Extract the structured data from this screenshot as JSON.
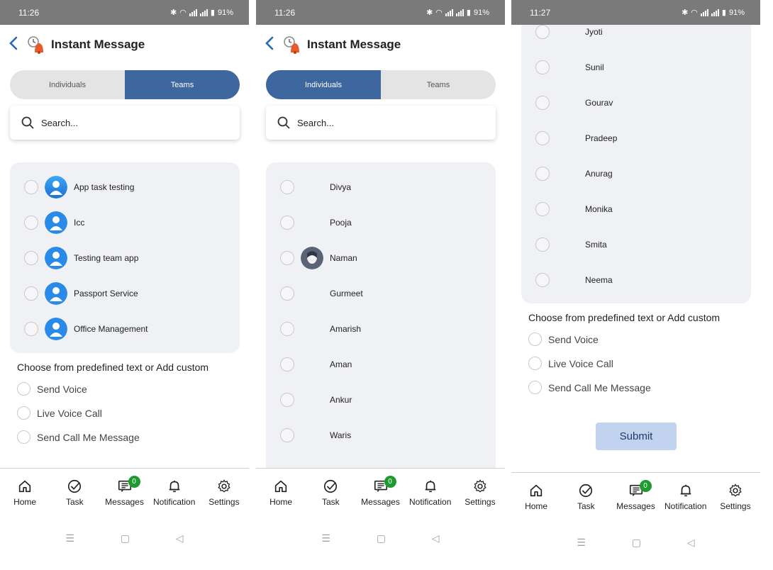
{
  "screens": [
    {
      "status": {
        "time": "11:26",
        "battery": "91%"
      },
      "header": {
        "title": "Instant Message"
      },
      "tabs": [
        {
          "label": "Individuals",
          "active": false
        },
        {
          "label": "Teams",
          "active": true
        }
      ],
      "search": {
        "placeholder": "Search..."
      },
      "list": [
        "App task testing",
        "Icc",
        "Testing team app",
        "Passport Service",
        "Office Management"
      ],
      "choose_text": "Choose from predefined text or Add custom",
      "options": [
        "Send Voice",
        "Live Voice Call",
        "Send Call Me Message"
      ]
    },
    {
      "status": {
        "time": "11:26",
        "battery": "91%"
      },
      "header": {
        "title": "Instant Message"
      },
      "tabs": [
        {
          "label": "Individuals",
          "active": true
        },
        {
          "label": "Teams",
          "active": false
        }
      ],
      "search": {
        "placeholder": "Search..."
      },
      "list": [
        "Divya",
        "Pooja",
        "Naman",
        "Gurmeet",
        "Amarish",
        "Aman",
        "Ankur",
        "Waris"
      ]
    },
    {
      "status": {
        "time": "11:27",
        "battery": "91%"
      },
      "list": [
        "Jyoti",
        "Sunil",
        "Gourav",
        "Pradeep",
        "Anurag",
        "Monika",
        "Smita",
        "Neema"
      ],
      "choose_text": "Choose from predefined text or Add custom",
      "options": [
        "Send Voice",
        "Live Voice Call",
        "Send Call Me Message"
      ],
      "submit_label": "Submit"
    }
  ],
  "nav": {
    "home": "Home",
    "task": "Task",
    "messages": "Messages",
    "messages_badge": "0",
    "notification": "Notification",
    "settings": "Settings"
  },
  "system_nav": {
    "menu_icon": "menu-icon",
    "home_icon": "square-icon",
    "back_icon": "triangle-back-icon"
  },
  "colors": {
    "accent": "#3d679e",
    "status_bar": "#7a7a7a",
    "badge": "#1e9a2e",
    "submit_bg": "#c2d3ef",
    "card_bg": "#f0f1f5"
  }
}
